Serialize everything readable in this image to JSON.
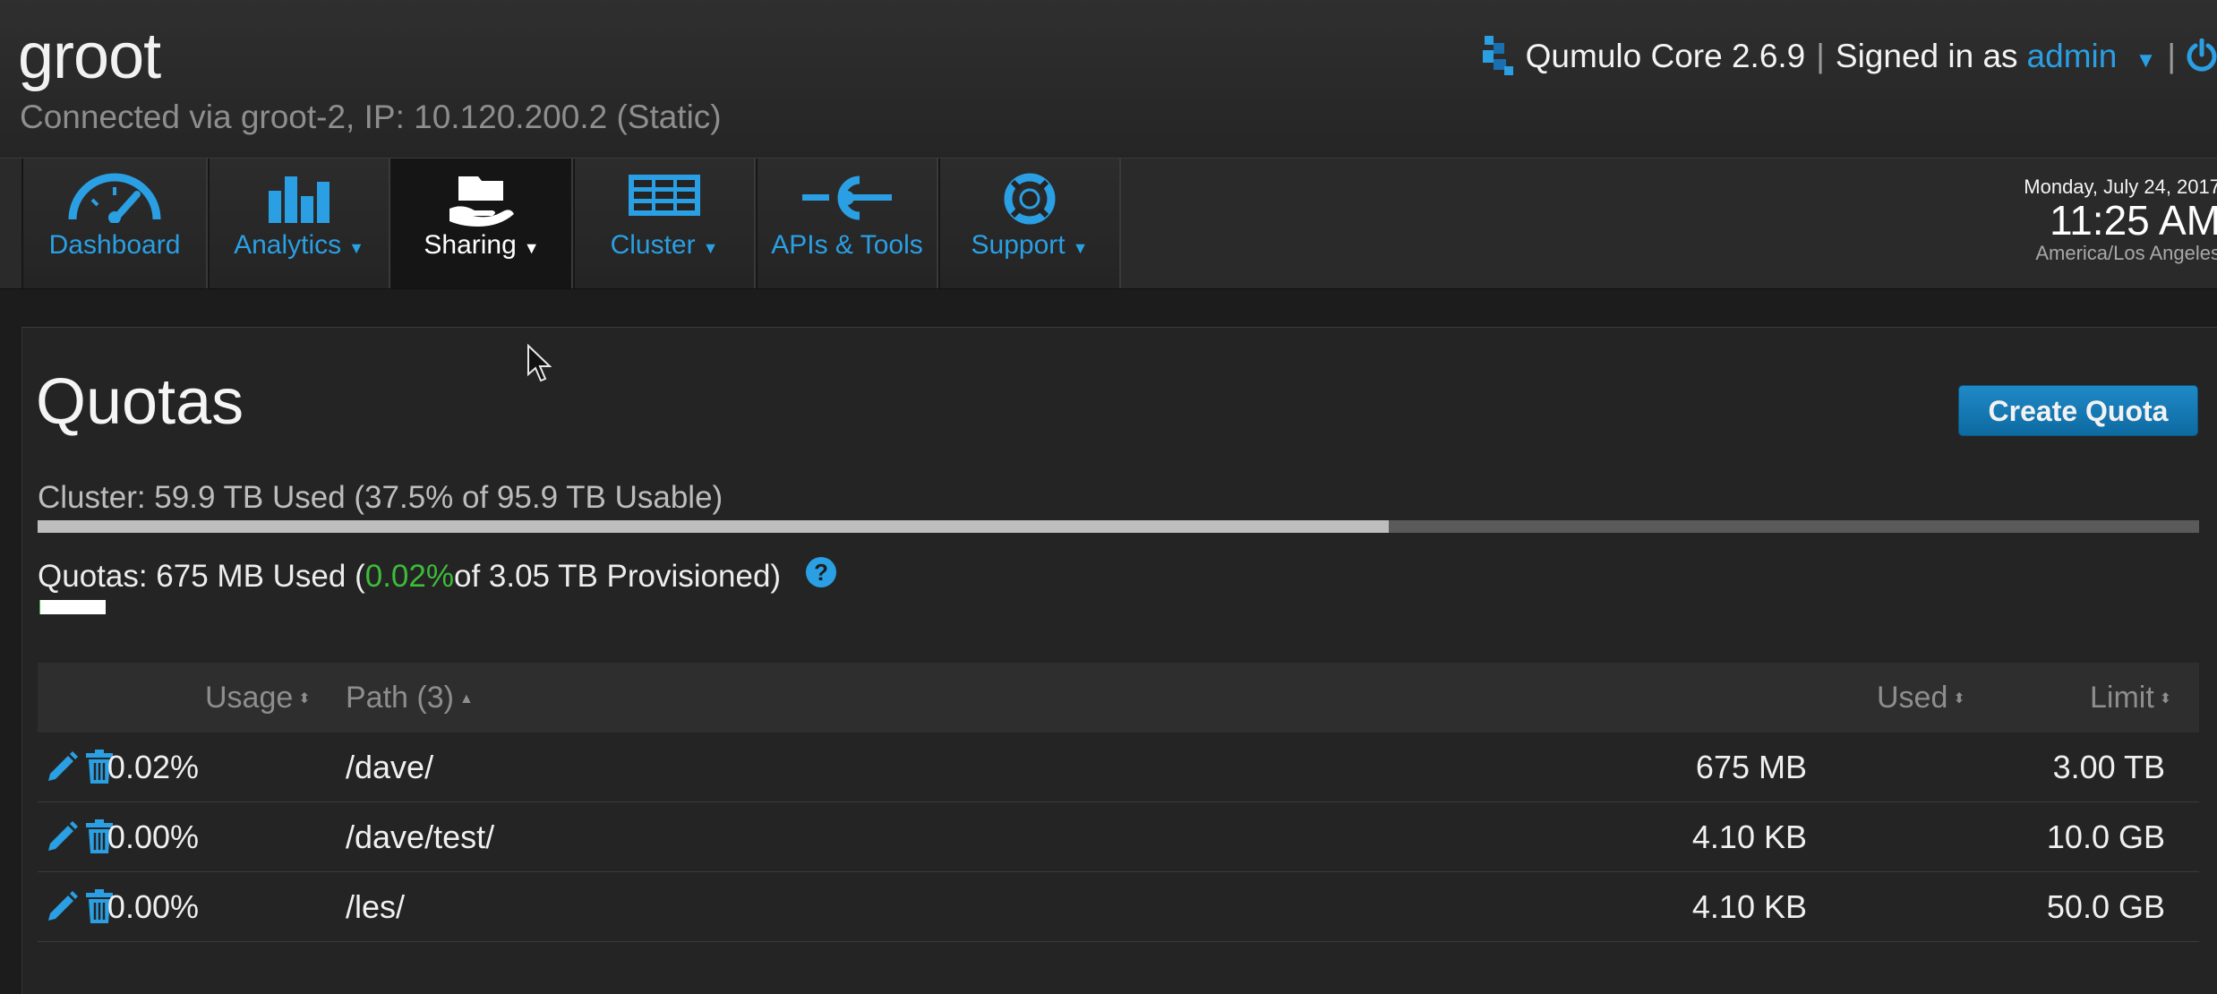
{
  "header": {
    "host_name": "groot",
    "connection": "Connected via groot-2, IP: 10.120.200.2 (Static)",
    "product": "Qumulo Core 2.6.9",
    "signed_in_label": "Signed in as",
    "user": "admin",
    "separator": "|"
  },
  "nav": {
    "items": [
      {
        "label": "Dashboard",
        "icon": "speedometer-icon"
      },
      {
        "label": "Analytics",
        "icon": "bar-chart-icon"
      },
      {
        "label": "Sharing",
        "icon": "sharing-hand-icon",
        "active": true
      },
      {
        "label": "Cluster",
        "icon": "cluster-grid-icon"
      },
      {
        "label": "APIs & Tools",
        "icon": "api-connector-icon"
      },
      {
        "label": "Support",
        "icon": "lifebuoy-icon"
      }
    ]
  },
  "clock": {
    "date": "Monday, July 24, 2017",
    "time": "11:25 AM",
    "timezone": "America/Los Angeles"
  },
  "page": {
    "title": "Quotas",
    "create_button": "Create Quota",
    "cluster_summary": "Cluster: 59.9 TB Used (37.5% of 95.9 TB Usable)",
    "cluster_used_fraction": 0.625,
    "quota_prefix": "Quotas: 675 MB Used (",
    "quota_pct": "0.02%",
    "quota_suffix": " of 3.05 TB Provisioned)",
    "quota_bar_fraction": 0.02
  },
  "table": {
    "headers": {
      "usage": "Usage",
      "path": "Path (3)",
      "used": "Used",
      "limit": "Limit"
    },
    "rows": [
      {
        "usage": "0.02%",
        "path": "/dave/",
        "used": "675 MB",
        "limit": "3.00 TB"
      },
      {
        "usage": "0.00%",
        "path": "/dave/test/",
        "used": "4.10 KB",
        "limit": "10.0 GB"
      },
      {
        "usage": "0.00%",
        "path": "/les/",
        "used": "4.10 KB",
        "limit": "50.0 GB"
      }
    ]
  },
  "colors": {
    "accent": "#2a9fe3",
    "green": "#3dbb3a",
    "button": "#1479b5"
  }
}
